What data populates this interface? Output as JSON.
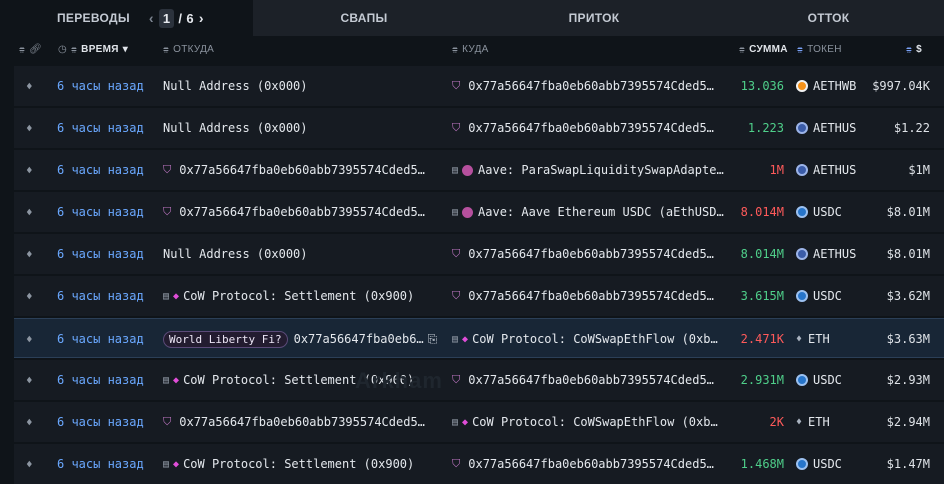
{
  "tabs": {
    "transfers": "ПЕРЕВОДЫ",
    "page_current": "1",
    "page_sep": "/",
    "page_total": "6",
    "swaps": "СВАПЫ",
    "inflow": "ПРИТОК",
    "outflow": "ОТТОК"
  },
  "columns": {
    "time": "ВРЕМЯ",
    "from": "ОТКУДА",
    "to": "КУДА",
    "amount": "СУММА",
    "token": "ТОКЕН",
    "usd": "$"
  },
  "watermark": "Arkham",
  "colors": {
    "positive": "#4fcf8a",
    "negative": "#ff5a5a",
    "time_link": "#6aa8ff",
    "accent": "#7aa2f7"
  },
  "rows": [
    {
      "time": "6 часы назад",
      "from": "Null Address (0x000)",
      "to": "0x77a56647fba0eb60abb7395574Cded5…",
      "amount": "13.036",
      "amount_sign": "pos",
      "token": "AETHWB",
      "usd": "$997.04K"
    },
    {
      "time": "6 часы назад",
      "from": "Null Address (0x000)",
      "to": "0x77a56647fba0eb60abb7395574Cded5…",
      "amount": "1.223",
      "amount_sign": "pos",
      "token": "AETHUS",
      "usd": "$1.22"
    },
    {
      "time": "6 часы назад",
      "from": "0x77a56647fba0eb60abb7395574Cded5…",
      "to": "Aave: ParaSwapLiquiditySwapAdapte…",
      "amount": "1M",
      "amount_sign": "neg",
      "token": "AETHUS",
      "usd": "$1M"
    },
    {
      "time": "6 часы назад",
      "from": "0x77a56647fba0eb60abb7395574Cded5…",
      "to": "Aave: Aave Ethereum USDC (aEthUSD…",
      "amount": "8.014M",
      "amount_sign": "neg",
      "token": "USDC",
      "usd": "$8.01M"
    },
    {
      "time": "6 часы назад",
      "from": "Null Address (0x000)",
      "to": "0x77a56647fba0eb60abb7395574Cded5…",
      "amount": "8.014M",
      "amount_sign": "pos",
      "token": "AETHUS",
      "usd": "$8.01M"
    },
    {
      "time": "6 часы назад",
      "from": "CoW Protocol: Settlement (0x900)",
      "to": "0x77a56647fba0eb60abb7395574Cded5…",
      "amount": "3.615M",
      "amount_sign": "pos",
      "token": "USDC",
      "usd": "$3.62M"
    },
    {
      "time": "6 часы назад",
      "from_tag": "World Liberty Fi?",
      "from": "0x77a56647fba0eb6…",
      "to": "CoW Protocol: CoWSwapEthFlow (0xb…",
      "amount": "2.471K",
      "amount_sign": "neg",
      "token": "ETH",
      "usd": "$3.63M"
    },
    {
      "time": "6 часы назад",
      "from": "CoW Protocol: Settlement (0x900)",
      "to": "0x77a56647fba0eb60abb7395574Cded5…",
      "amount": "2.931M",
      "amount_sign": "pos",
      "token": "USDC",
      "usd": "$2.93M"
    },
    {
      "time": "6 часы назад",
      "from": "0x77a56647fba0eb60abb7395574Cded5…",
      "to": "CoW Protocol: CoWSwapEthFlow (0xb…",
      "amount": "2K",
      "amount_sign": "neg",
      "token": "ETH",
      "usd": "$2.94M"
    },
    {
      "time": "6 часы назад",
      "from": "CoW Protocol: Settlement (0x900)",
      "to": "0x77a56647fba0eb60abb7395574Cded5…",
      "amount": "1.468M",
      "amount_sign": "pos",
      "token": "USDC",
      "usd": "$1.47M"
    }
  ]
}
